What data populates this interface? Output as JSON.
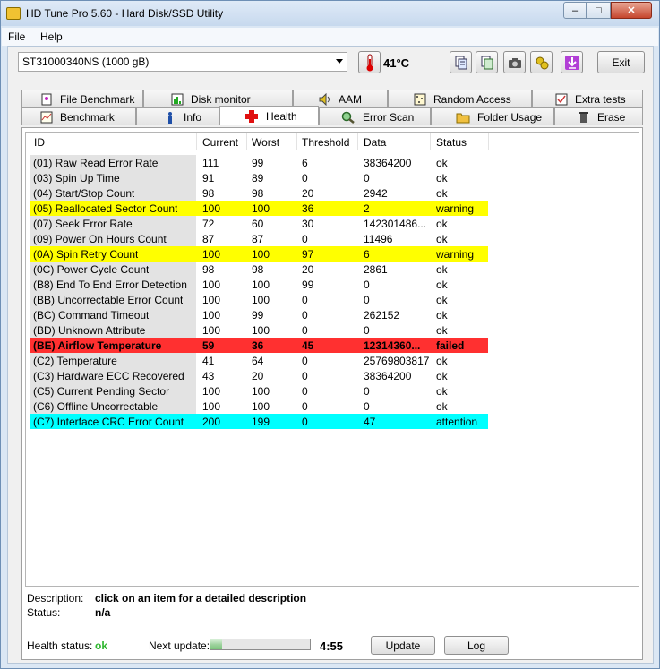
{
  "window": {
    "title": "HD Tune Pro 5.60 - Hard Disk/SSD Utility",
    "controls": {
      "minimize": "–",
      "maximize": "□",
      "close": "✕"
    }
  },
  "menu": [
    "File",
    "Help"
  ],
  "toolbar": {
    "drive": "ST31000340NS (1000 gB)",
    "temperature": "41°C",
    "exit_label": "Exit",
    "icons": [
      "copy-text-icon",
      "copy-screenshot-icon",
      "camera-icon",
      "settings-icon",
      "save-icon"
    ]
  },
  "tabs_top": [
    {
      "label": "File Benchmark",
      "icon": "file-benchmark-icon"
    },
    {
      "label": "Disk monitor",
      "icon": "disk-monitor-icon"
    },
    {
      "label": "AAM",
      "icon": "speaker-icon"
    },
    {
      "label": "Random Access",
      "icon": "random-access-icon"
    },
    {
      "label": "Extra tests",
      "icon": "extra-tests-icon"
    }
  ],
  "tabs_bottom": [
    {
      "label": "Benchmark",
      "icon": "benchmark-icon"
    },
    {
      "label": "Info",
      "icon": "info-icon"
    },
    {
      "label": "Health",
      "icon": "health-cross-icon",
      "active": true
    },
    {
      "label": "Error Scan",
      "icon": "magnifier-icon"
    },
    {
      "label": "Folder Usage",
      "icon": "folder-icon"
    },
    {
      "label": "Erase",
      "icon": "trash-icon"
    }
  ],
  "table": {
    "headers": [
      "ID",
      "Current",
      "Worst",
      "Threshold",
      "Data",
      "Status"
    ],
    "rows": [
      {
        "id": "(01) Raw Read Error Rate",
        "current": "111",
        "worst": "99",
        "threshold": "6",
        "data": "38364200",
        "status": "ok",
        "level": "ok"
      },
      {
        "id": "(03) Spin Up Time",
        "current": "91",
        "worst": "89",
        "threshold": "0",
        "data": "0",
        "status": "ok",
        "level": "ok"
      },
      {
        "id": "(04) Start/Stop Count",
        "current": "98",
        "worst": "98",
        "threshold": "20",
        "data": "2942",
        "status": "ok",
        "level": "ok"
      },
      {
        "id": "(05) Reallocated Sector Count",
        "current": "100",
        "worst": "100",
        "threshold": "36",
        "data": "2",
        "status": "warning",
        "level": "warn"
      },
      {
        "id": "(07) Seek Error Rate",
        "current": "72",
        "worst": "60",
        "threshold": "30",
        "data": "142301486...",
        "status": "ok",
        "level": "ok"
      },
      {
        "id": "(09) Power On Hours Count",
        "current": "87",
        "worst": "87",
        "threshold": "0",
        "data": "11496",
        "status": "ok",
        "level": "ok"
      },
      {
        "id": "(0A) Spin Retry Count",
        "current": "100",
        "worst": "100",
        "threshold": "97",
        "data": "6",
        "status": "warning",
        "level": "warn"
      },
      {
        "id": "(0C) Power Cycle Count",
        "current": "98",
        "worst": "98",
        "threshold": "20",
        "data": "2861",
        "status": "ok",
        "level": "ok"
      },
      {
        "id": "(B8) End To End Error Detection",
        "current": "100",
        "worst": "100",
        "threshold": "99",
        "data": "0",
        "status": "ok",
        "level": "ok"
      },
      {
        "id": "(BB) Uncorrectable Error Count",
        "current": "100",
        "worst": "100",
        "threshold": "0",
        "data": "0",
        "status": "ok",
        "level": "ok"
      },
      {
        "id": "(BC) Command Timeout",
        "current": "100",
        "worst": "99",
        "threshold": "0",
        "data": "262152",
        "status": "ok",
        "level": "ok"
      },
      {
        "id": "(BD) Unknown Attribute",
        "current": "100",
        "worst": "100",
        "threshold": "0",
        "data": "0",
        "status": "ok",
        "level": "ok"
      },
      {
        "id": "(BE) Airflow Temperature",
        "current": "59",
        "worst": "36",
        "threshold": "45",
        "data": "12314360...",
        "status": "failed",
        "level": "fail"
      },
      {
        "id": "(C2) Temperature",
        "current": "41",
        "worst": "64",
        "threshold": "0",
        "data": "25769803817",
        "status": "ok",
        "level": "ok"
      },
      {
        "id": "(C3) Hardware ECC Recovered",
        "current": "43",
        "worst": "20",
        "threshold": "0",
        "data": "38364200",
        "status": "ok",
        "level": "ok"
      },
      {
        "id": "(C5) Current Pending Sector",
        "current": "100",
        "worst": "100",
        "threshold": "0",
        "data": "0",
        "status": "ok",
        "level": "ok"
      },
      {
        "id": "(C6) Offline Uncorrectable",
        "current": "100",
        "worst": "100",
        "threshold": "0",
        "data": "0",
        "status": "ok",
        "level": "ok"
      },
      {
        "id": "(C7) Interface CRC Error Count",
        "current": "200",
        "worst": "199",
        "threshold": "0",
        "data": "47",
        "status": "attention",
        "level": "attn"
      }
    ]
  },
  "details": {
    "description_label": "Description:",
    "description_value": "click on an item for a detailed description",
    "status_label": "Status:",
    "status_value": "n/a"
  },
  "footer": {
    "health_label": "Health status:",
    "health_value": "ok",
    "next_update_label": "Next update:",
    "next_update_value": "4:55",
    "progress_fraction": 0.12,
    "update_label": "Update",
    "log_label": "Log"
  },
  "colors": {
    "warning": "#ffff00",
    "failed": "#ff3030",
    "attention": "#00ffff",
    "health_ok": "#2fb62f"
  }
}
